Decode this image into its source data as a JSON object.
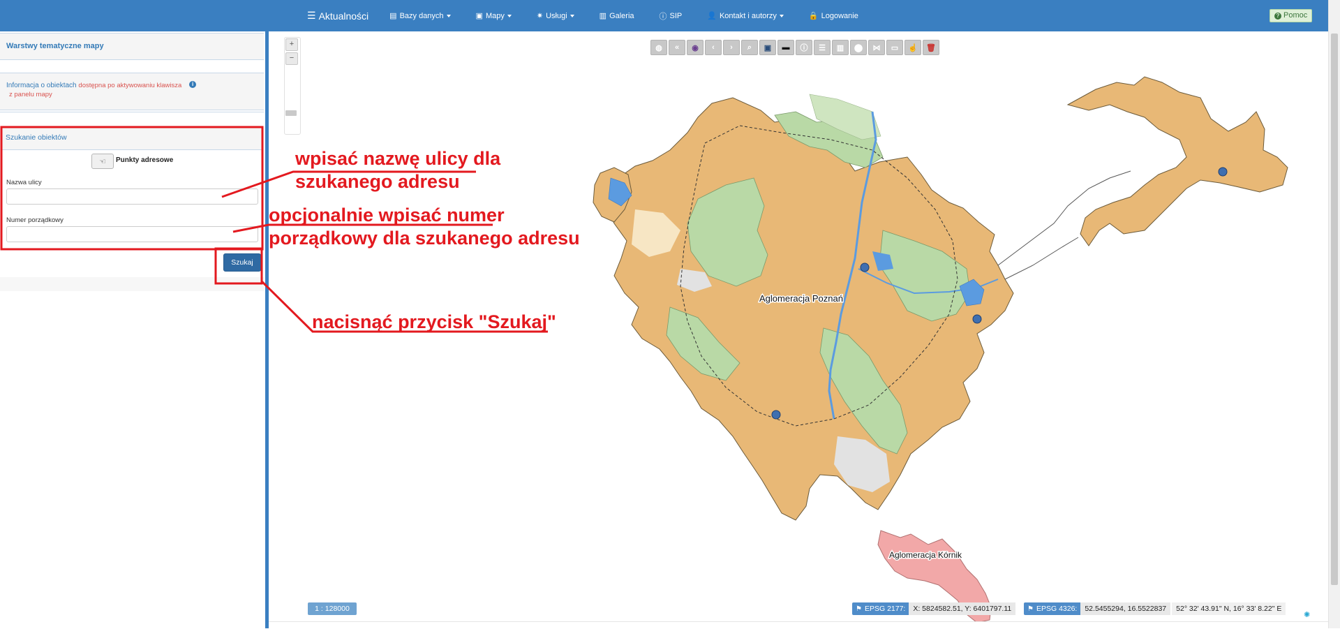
{
  "navbar": {
    "items": [
      {
        "label": "Aktualności",
        "icon": "menu-icon",
        "caret": false
      },
      {
        "label": "Bazy danych",
        "icon": "database-icon",
        "caret": true
      },
      {
        "label": "Mapy",
        "icon": "map-icon",
        "caret": true
      },
      {
        "label": "Usługi",
        "icon": "gear-icon",
        "caret": true
      },
      {
        "label": "Galeria",
        "icon": "gallery-icon",
        "caret": false
      },
      {
        "label": "SIP",
        "icon": "info-icon",
        "caret": false
      },
      {
        "label": "Kontakt i autorzy",
        "icon": "user-icon",
        "caret": true
      },
      {
        "label": "Logowanie",
        "icon": "lock-icon",
        "caret": false
      }
    ],
    "help_label": "Pomoc"
  },
  "sidebar": {
    "layers_title": "Warstwy tematyczne mapy",
    "info_title": "Informacja o obiektach",
    "info_note_1": "dostępna po aktywowaniu klawisza",
    "info_note_2": "z panelu mapy",
    "search_title": "Szukanie obiektów",
    "address_points_label": "Punkty adresowe",
    "street_label": "Nazwa ulicy",
    "street_value": "",
    "number_label": "Numer porządkowy",
    "number_value": "",
    "search_button": "Szukaj"
  },
  "map": {
    "labels": {
      "poznan": "Aglomeracja Poznań",
      "kornik": "Aglomeracja Kórnik"
    },
    "colors": {
      "urban": "#e8b876",
      "green": "#b9d9a6",
      "water": "#5b9be0",
      "kornik": "#f2a8a8",
      "marker": "#3f6fb0"
    },
    "toolbar_icons": [
      "globe-icon",
      "double-left-icon",
      "eye-slash-icon",
      "prev-icon",
      "next-icon",
      "search-icon",
      "print-icon",
      "ruler-icon",
      "info-icon",
      "list-icon",
      "columns-icon",
      "marker-icon",
      "share-icon",
      "rectangle-icon",
      "hand-icon",
      "trash-icon"
    ],
    "zoom_in": "+",
    "zoom_out": "−",
    "scale": "1 : 128000",
    "epsg2177_label": "EPSG 2177:",
    "epsg2177_value": "X: 5824582.51, Y: 6401797.11",
    "epsg4326_label": "EPSG 4326:",
    "epsg4326_value": "52.5455294, 16.5522837",
    "dms_value": "52° 32' 43.91\" N, 16° 33' 8.22\" E"
  },
  "annotations": {
    "street_1": "wpisać nazwę ulicy dla",
    "street_2": "szukanego adresu",
    "number_1": "opcjonalnie wpisać numer",
    "number_2": "porządkowy dla szukanego adresu",
    "button": "nacisnąć przycisk \"Szukaj\""
  }
}
